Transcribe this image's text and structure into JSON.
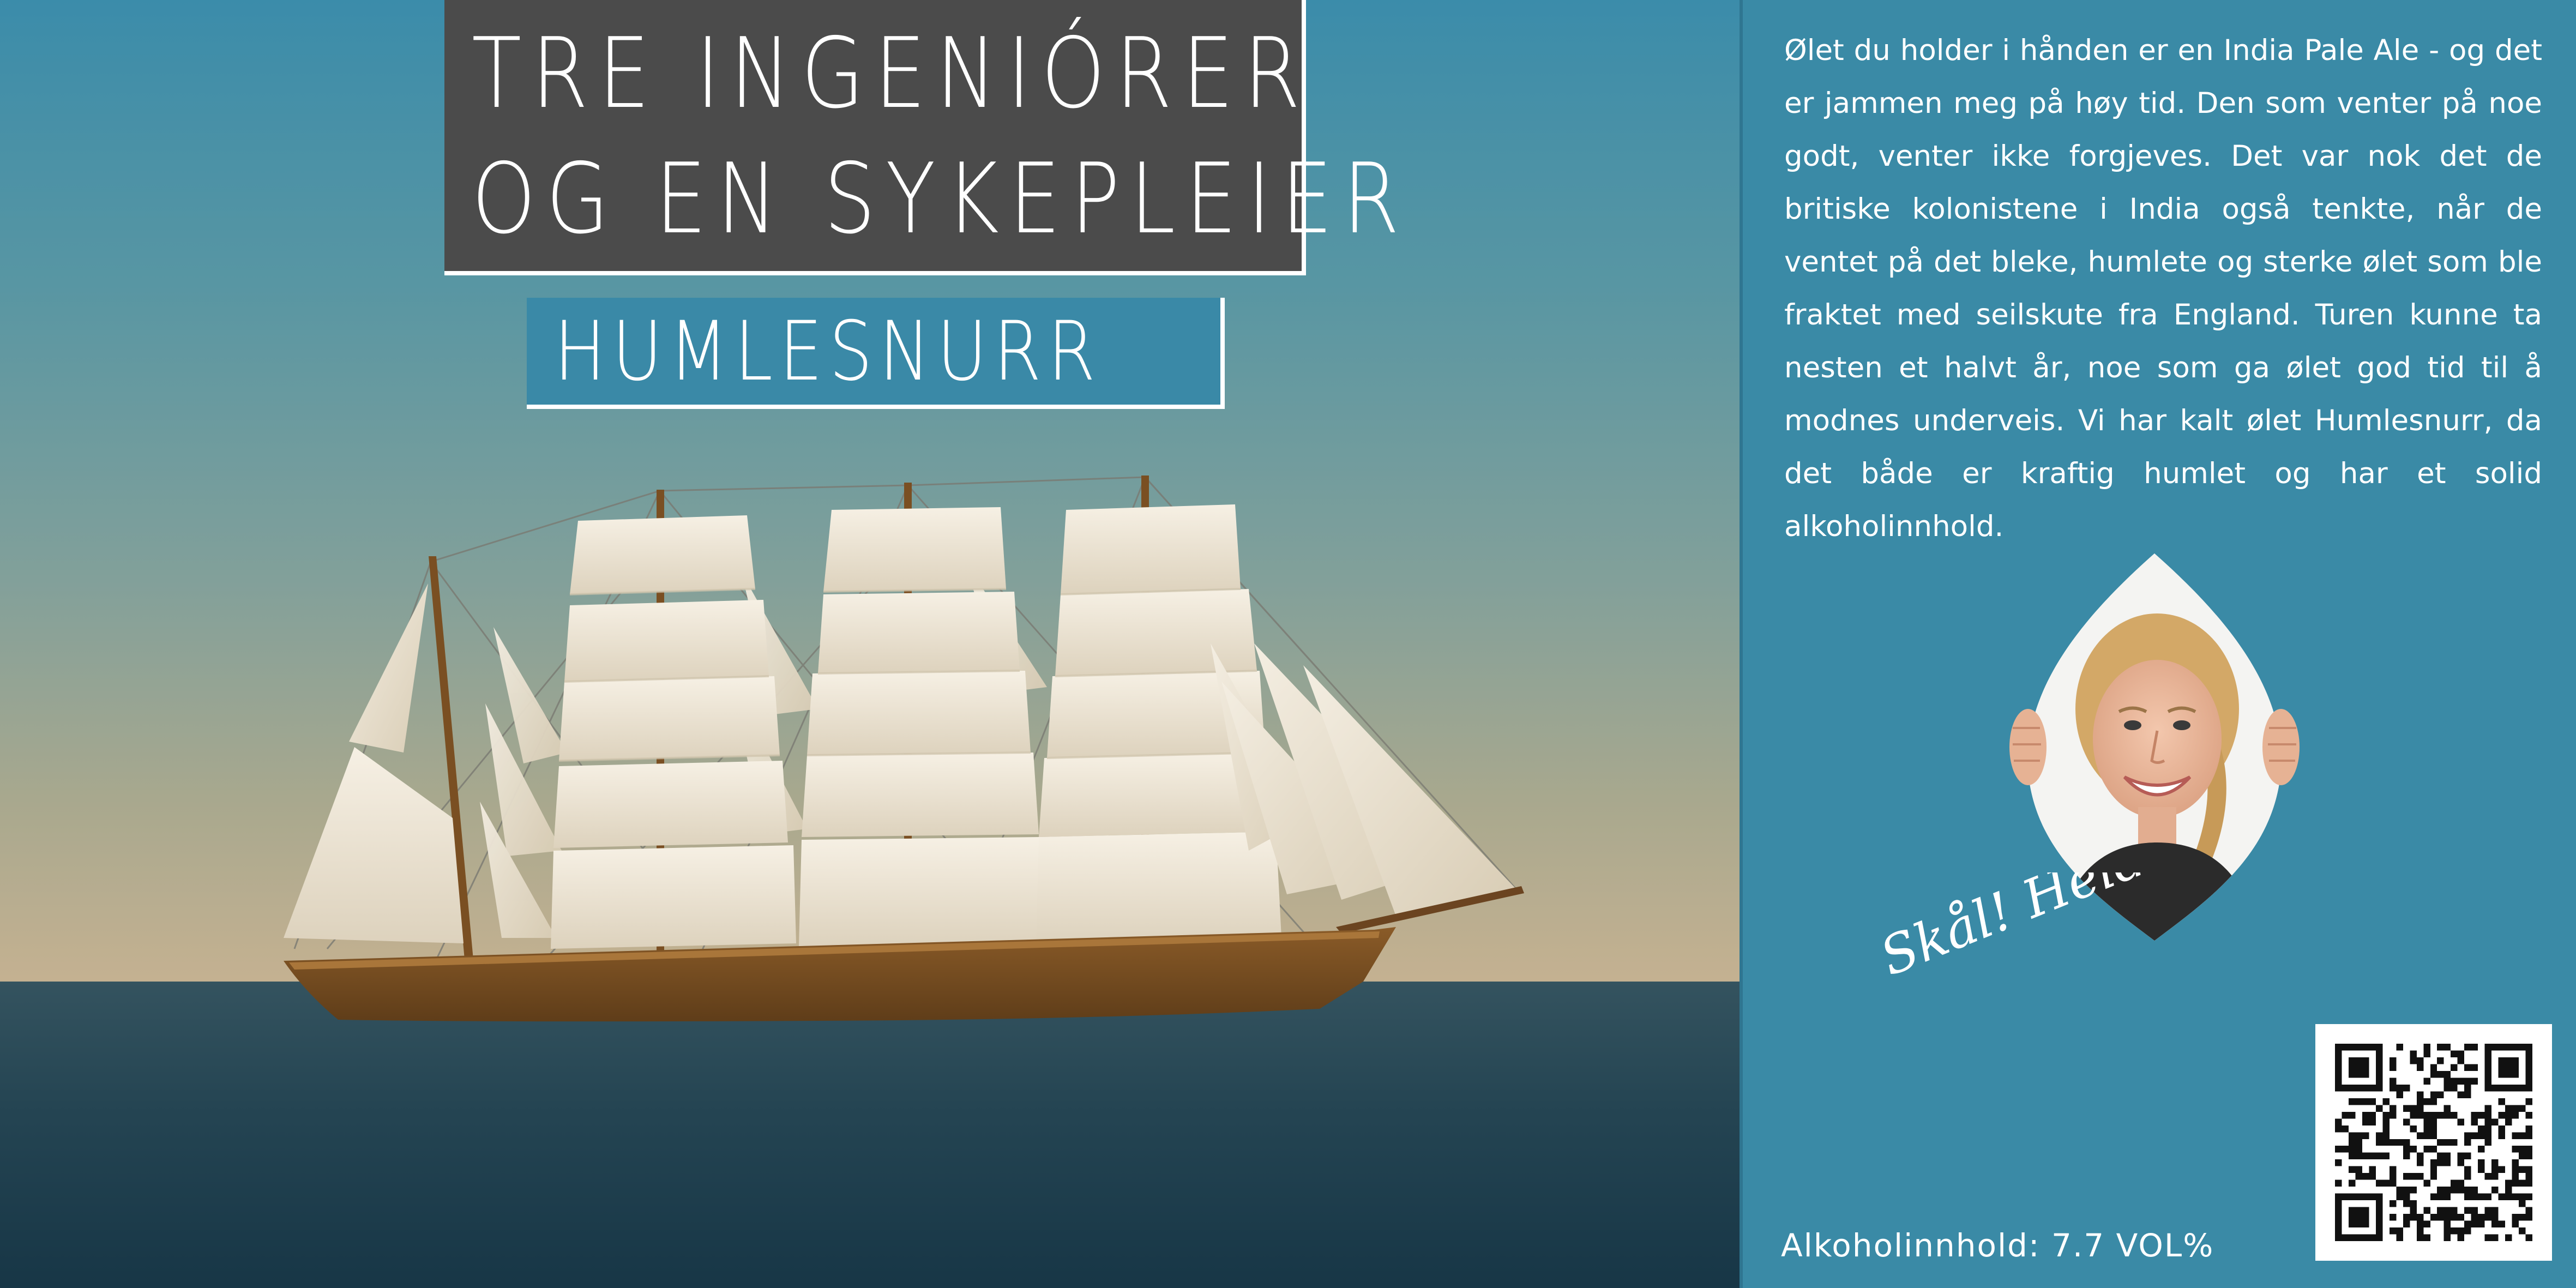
{
  "label": {
    "title_line_1": "TRE INGENIÓRER",
    "title_line_2": "OG EN SYKEPLEIER",
    "beer_name": "HUMLESNURR",
    "description": "Ølet du holder i hånden er en India Pale Ale - og det er jammen meg på høy tid. Den som venter på noe godt, venter ikke forgjeves. Det var nok det de britiske kolonistene i India også tenkte, når de ventet på det bleke, humlete og sterke ølet som ble fraktet med seilskute fra England. Turen kunne ta nesten et halvt år, noe som ga ølet god tid til å modnes underveis. Vi har kalt ølet Humlesnurr, da det både er kraftig humlet og har et solid alkoholinnhold.",
    "signature": "Skål! Heidi",
    "alcohol_content": "Alkoholinnhold: 7.7 VOL%"
  },
  "colors": {
    "title_box": "#4b4b4b",
    "accent_blue": "#3a8aa6",
    "hull_brown": "#7a4f22",
    "sail_cream": "#f2ebde",
    "sea_dark": "#173646"
  },
  "icons": {
    "ship": "four-masted-sailing-ship-illustration",
    "portrait": "smiling-woman-portrait-in-leaf-shaped-frame",
    "qr": "qr-code"
  }
}
